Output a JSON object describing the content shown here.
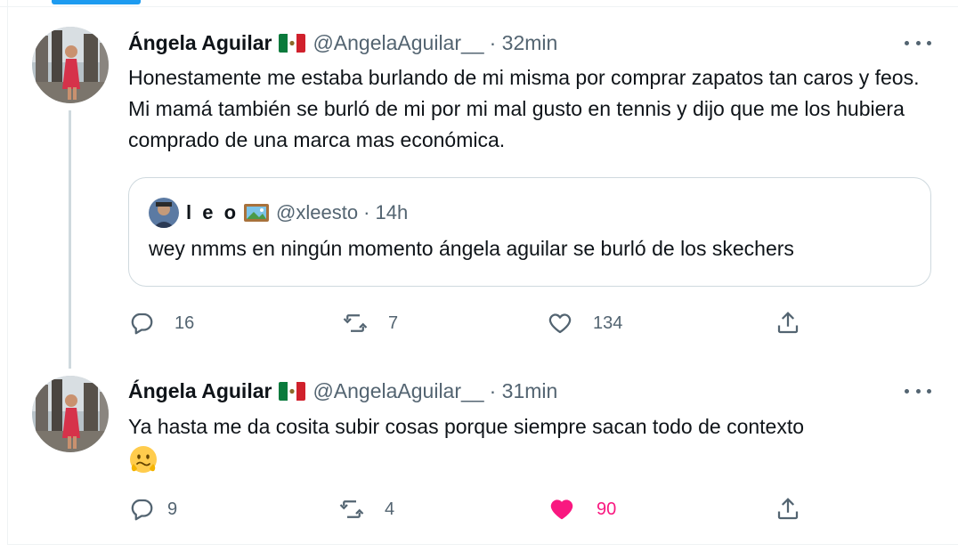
{
  "tweets": [
    {
      "name": "Ángela Aguilar",
      "flag_icon": "mexico-flag-icon",
      "handle": "@AngelaAguilar__",
      "time": "· 32min",
      "text": "Honestamente me estaba burlando de mi misma por comprar zapatos tan caros y feos. Mi mamá también se burló de mi por mi mal gusto en tennis y dijo que me los hubiera comprado de una marca mas económica.",
      "quote": {
        "name": "l e o",
        "badge_icon": "framed-picture-icon",
        "handle": "@xleesto",
        "time": "· 14h",
        "text": "wey nmms en ningún momento ángela aguilar se burló de los skechers"
      },
      "actions": {
        "replies": "16",
        "retweets": "7",
        "likes": "134",
        "liked": false
      }
    },
    {
      "name": "Ángela Aguilar",
      "flag_icon": "mexico-flag-icon",
      "handle": "@AngelaAguilar__",
      "time": "· 31min",
      "text": "Ya hasta me da cosita subir cosas porque siempre sacan todo de contexto",
      "emoji_icon": "wavy-mouth-face-emoji",
      "actions": {
        "replies": "9",
        "retweets": "4",
        "likes": "90",
        "liked": true
      }
    }
  ],
  "colors": {
    "accent": "#1d9bf0",
    "like": "#f91880",
    "muted": "#536471",
    "text": "#0f1419",
    "border": "#cfd9de"
  }
}
